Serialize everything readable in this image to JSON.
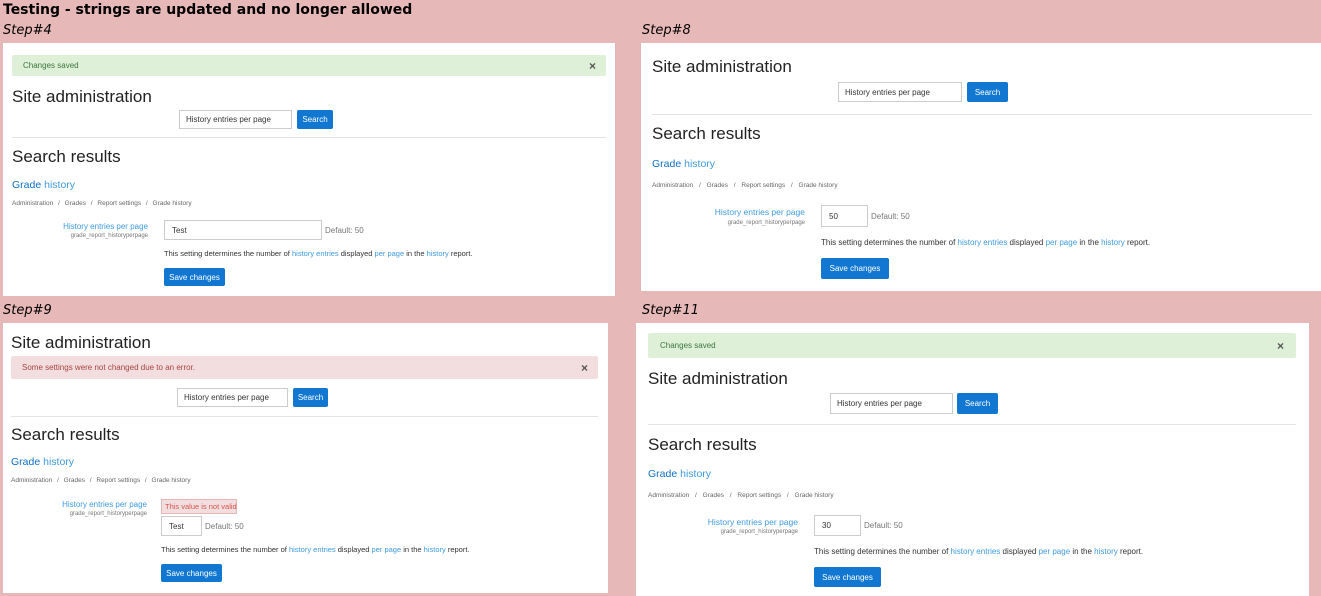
{
  "heading": "Testing - strings are updated and no longer allowed",
  "common": {
    "site_admin_title": "Site administration",
    "search_value": "History entries per page",
    "search_button": "Search",
    "search_results_title": "Search results",
    "grade_word": "Grade",
    "history_word": "history",
    "breadcrumb": [
      "Administration",
      "Grades",
      "Report settings",
      "Grade history"
    ],
    "crumb_sep": "/",
    "setting_name": "History entries per page",
    "setting_id": "grade_report_historyperpage",
    "default_text": "Default: 50",
    "desc": [
      "This setting determines the number of ",
      "history entries",
      " displayed ",
      "per page",
      " in the ",
      "history",
      " report."
    ],
    "save_button": "Save changes",
    "close_icon": "×",
    "close_icon_name": "close-icon"
  },
  "steps": [
    {
      "label": "Step#4",
      "alert_type": "success",
      "alert_text": "Changes saved",
      "value": "Test"
    },
    {
      "label": "Step#8",
      "value": "50"
    },
    {
      "label": "Step#9",
      "alert_type": "danger",
      "alert_text": "Some settings were not changed due to an error.",
      "error_text": "This value is not valid",
      "value": "Test"
    },
    {
      "label": "Step#11",
      "alert_type": "success",
      "alert_text": "Changes saved",
      "value": "30"
    }
  ],
  "colors": {
    "background": "#e6b8b7",
    "accent_button": "#1177d1",
    "link": "#3d9be0",
    "success_bg": "#dff0d8",
    "danger_bg": "#f2dede"
  }
}
